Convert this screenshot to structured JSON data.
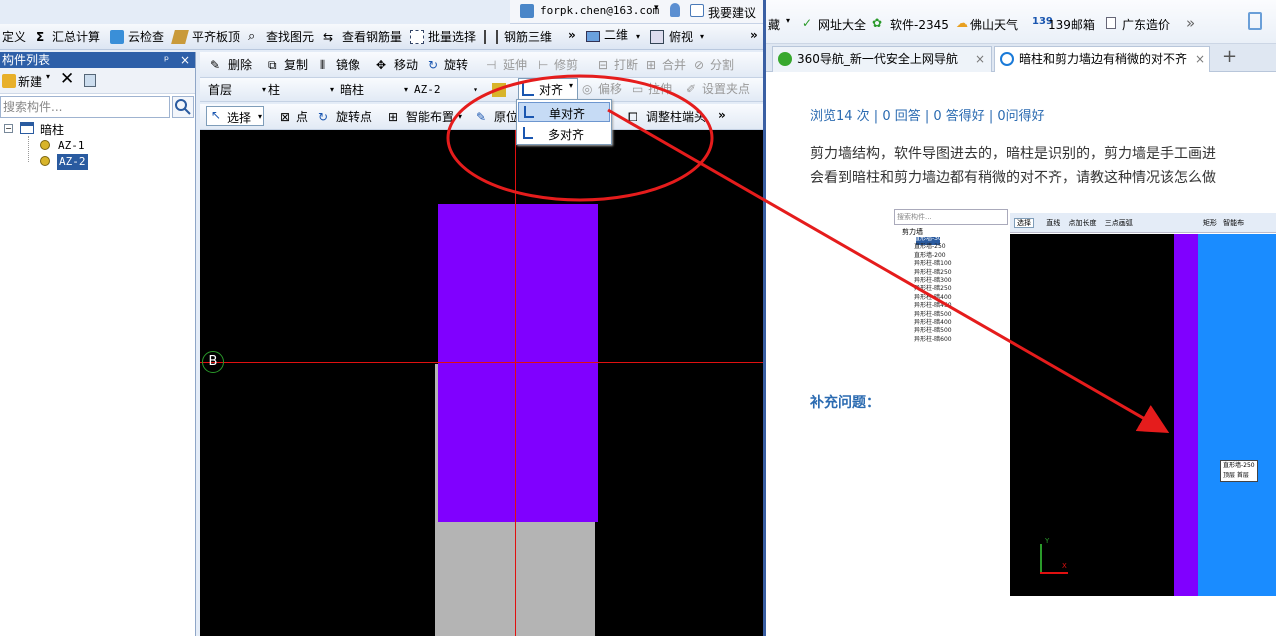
{
  "app": {
    "user": {
      "email": "forpk.chen@163.com",
      "suggest": "我要建议"
    },
    "menu": [
      "定义",
      "汇总计算",
      "云检查",
      "平齐板顶",
      "查找图元",
      "查看钢筋量",
      "批量选择",
      "钢筋三维"
    ],
    "menu_more": "»",
    "view_2d": "二维",
    "view_top": "俯视",
    "panel": {
      "title": "构件列表",
      "pin": "ᵖ",
      "close": "×",
      "new_btn": "新建",
      "search_placeholder": "搜索构件...",
      "tree_root": "暗柱",
      "tree_items": [
        "AZ-1",
        "AZ-2"
      ]
    },
    "toolbar1": {
      "delete": "删除",
      "copy": "复制",
      "mirror": "镜像",
      "move": "移动",
      "rotate": "旋转",
      "extend": "延伸",
      "trim": "修剪",
      "break": "打断",
      "merge": "合并",
      "split": "分割",
      "align": "对齐",
      "offset": "偏移",
      "stretch": "拉伸",
      "set_point": "设置夹点"
    },
    "toolbar2": {
      "floor": "首层",
      "category": "柱",
      "type": "暗柱",
      "name": "AZ-2"
    },
    "toolbar3": {
      "select": "选择",
      "point": "点",
      "rotate_point": "旋转点",
      "smart_layout": "智能布置",
      "origin": "原位",
      "adjust_end": "调整柱端头",
      "more": "»"
    },
    "dropdown": [
      "单对齐",
      "多对齐"
    ],
    "axis_label": "B"
  },
  "browser": {
    "bookmarks": [
      "藏",
      "网址大全",
      "软件-2345",
      "佛山天气",
      "139邮箱",
      "广东造价",
      "»"
    ],
    "tabs": [
      {
        "title": "360导航_新一代安全上网导航",
        "close": "×"
      },
      {
        "title": "暗柱和剪力墙边有稍微的对不齐",
        "close": "×"
      }
    ],
    "new_tab": "+",
    "stats": "浏览14 次 | 0 回答 | 0 答得好 | 0问得好",
    "question": [
      "剪力墙结构，软件导图进去的，暗柱是识别的，剪力墙是手工画进",
      "会看到暗柱和剪力墙边都有稍微的对不齐，请教这种情况该怎么做"
    ],
    "supplement": "补充问题：",
    "embed": {
      "search": "搜索构件...",
      "root": "剪力墙",
      "items": [
        "直形墙-300",
        "直形墙-250",
        "直形墙-200",
        "异形柱-暗100",
        "异形柱-暗250",
        "异形柱-暗300",
        "异形柱-暗250",
        "异形柱-暗400",
        "异形柱-暗450",
        "异形柱-暗500",
        "异形柱-暗400",
        "异形柱-暗500",
        "异形柱-暗600"
      ],
      "toolbar": [
        "选择",
        "直线",
        "点加长度",
        "三点画弧",
        "矩形",
        "智能布"
      ],
      "tooltip": [
        "直形墙-250",
        "顶层 首层"
      ],
      "axis_y": "Y",
      "axis_x": "X"
    }
  },
  "colors": {
    "purple": "#8000ff",
    "gray": "#b4b4b4",
    "red": "#e01010",
    "blue": "#1a8cff",
    "annotation": "#e51c1c"
  }
}
